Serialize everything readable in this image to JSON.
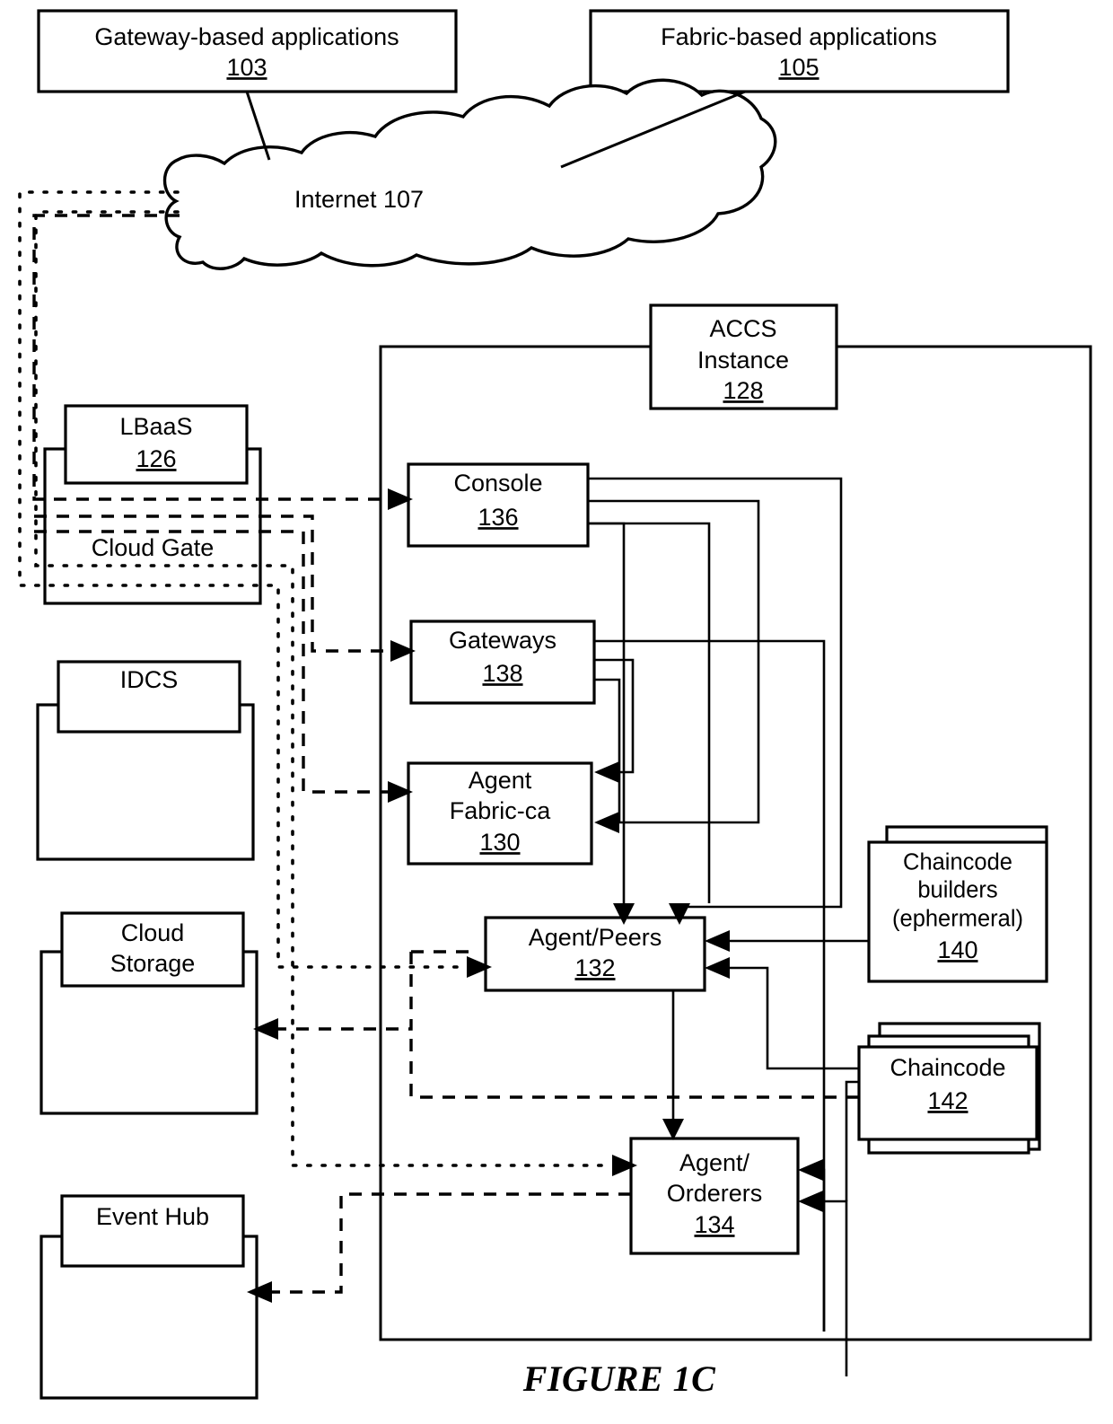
{
  "figure": {
    "label": "FIGURE 1C",
    "type": "system-architecture-block-diagram"
  },
  "nodes": {
    "gateway_apps": {
      "title": "Gateway-based applications",
      "ref": "103"
    },
    "fabric_apps": {
      "title": "Fabric-based applications",
      "ref": "105"
    },
    "internet": {
      "title": "Internet 107"
    },
    "lbaas": {
      "title": "LBaaS",
      "ref": "126"
    },
    "cloud_gate": {
      "title": "Cloud Gate"
    },
    "idcs": {
      "title": "IDCS"
    },
    "cloud_storage": {
      "title_line1": "Cloud",
      "title_line2": "Storage"
    },
    "event_hub": {
      "title": "Event Hub"
    },
    "accs_instance": {
      "title_line1": "ACCS",
      "title_line2": "Instance",
      "ref": "128"
    },
    "console": {
      "title": "Console",
      "ref": "136"
    },
    "gateways": {
      "title": "Gateways",
      "ref": "138"
    },
    "agent_fabric_ca": {
      "title_line1": "Agent",
      "title_line2": "Fabric-ca",
      "ref": "130"
    },
    "agent_peers": {
      "title": "Agent/Peers",
      "ref": "132"
    },
    "agent_orderers": {
      "title_line1": "Agent/",
      "title_line2": "Orderers",
      "ref": "134"
    },
    "chaincode_builders": {
      "title_line1": "Chaincode",
      "title_line2": "builders",
      "title_line3": "(ephermeral)",
      "ref": "140"
    },
    "chaincode": {
      "title": "Chaincode",
      "ref": "142"
    }
  },
  "colors": {
    "stroke": "#000000",
    "fill": "#ffffff"
  }
}
